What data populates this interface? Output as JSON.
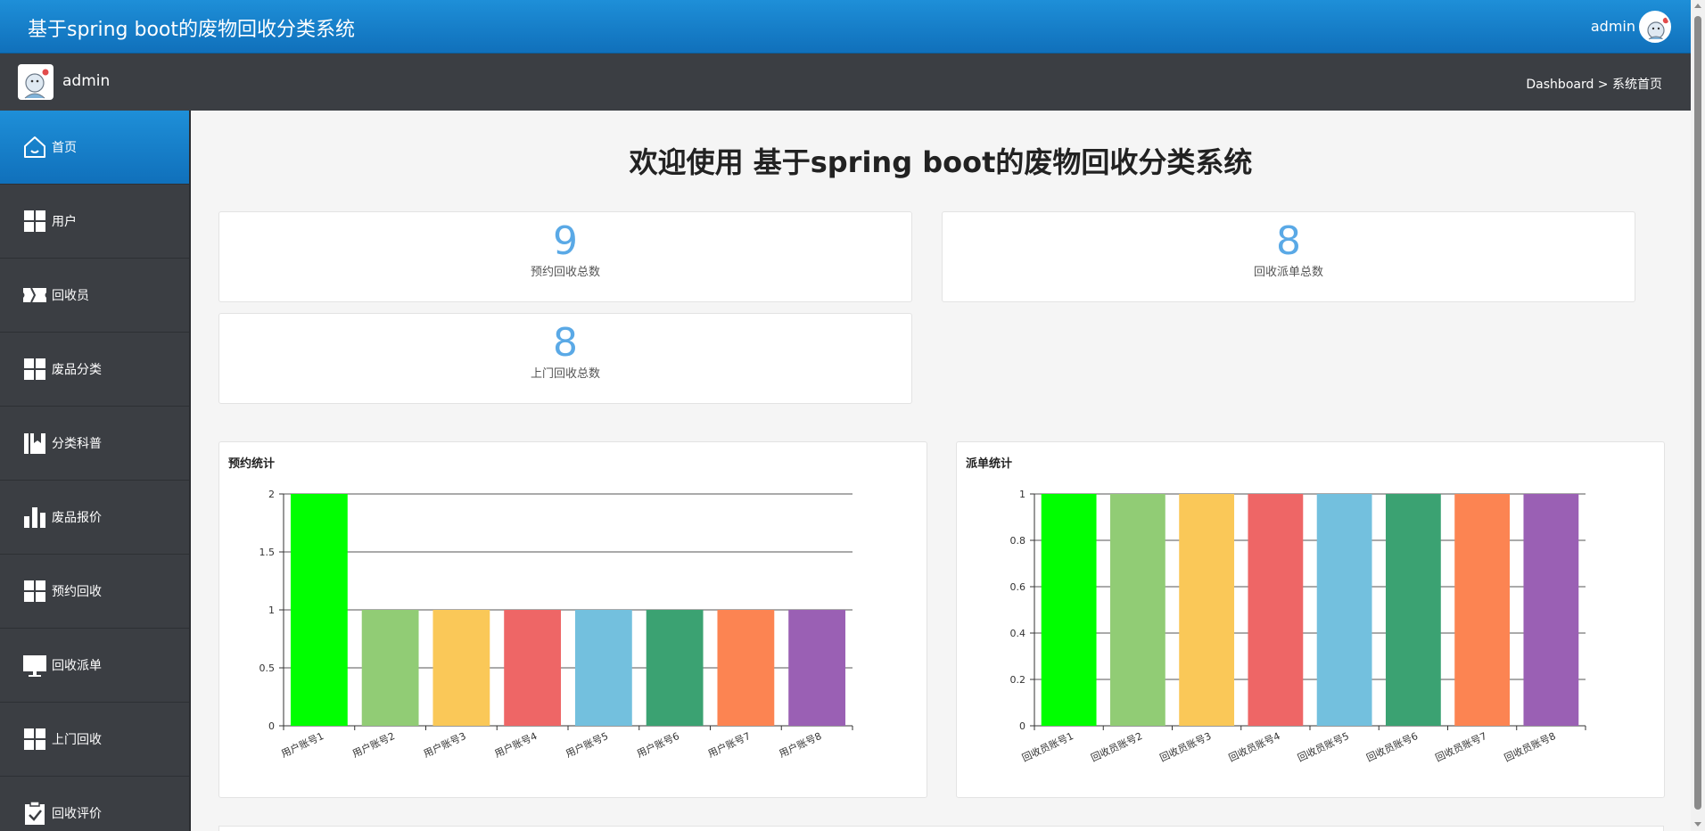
{
  "header": {
    "title": "基于spring boot的废物回收分类系统",
    "user": "admin"
  },
  "subbar": {
    "user": "admin",
    "breadcrumb": "Dashboard > 系统首页"
  },
  "sidebar": {
    "items": [
      {
        "label": "首页",
        "icon": "home-icon",
        "active": true
      },
      {
        "label": "用户",
        "icon": "grid-icon"
      },
      {
        "label": "回收员",
        "icon": "ticket-icon"
      },
      {
        "label": "废品分类",
        "icon": "grid-icon"
      },
      {
        "label": "分类科普",
        "icon": "bookmark-icon"
      },
      {
        "label": "废品报价",
        "icon": "bar-chart-icon"
      },
      {
        "label": "预约回收",
        "icon": "grid-icon"
      },
      {
        "label": "回收派单",
        "icon": "monitor-icon"
      },
      {
        "label": "上门回收",
        "icon": "grid-icon"
      },
      {
        "label": "回收评价",
        "icon": "clipboard-check-icon"
      }
    ]
  },
  "main": {
    "welcome": "欢迎使用 基于spring boot的废物回收分类系统",
    "stats": [
      {
        "value": "9",
        "label": "预约回收总数"
      },
      {
        "value": "8",
        "label": "回收派单总数"
      },
      {
        "value": "8",
        "label": "上门回收总数"
      }
    ],
    "chart_titles": [
      "预约统计",
      "派单统计"
    ]
  },
  "colors": {
    "accent": "#1a82cf",
    "bars": [
      "#00ff00",
      "#91cc75",
      "#fac858",
      "#ee6666",
      "#73c0de",
      "#3ba272",
      "#fc8452",
      "#9a60b4"
    ]
  },
  "chart_data": [
    {
      "type": "bar",
      "title": "预约统计",
      "categories": [
        "用户账号1",
        "用户账号2",
        "用户账号3",
        "用户账号4",
        "用户账号5",
        "用户账号6",
        "用户账号7",
        "用户账号8"
      ],
      "values": [
        2,
        1,
        1,
        1,
        1,
        1,
        1,
        1
      ],
      "ylim": [
        0,
        2
      ],
      "yticks": [
        "0",
        "0.5",
        "1",
        "1.5",
        "2"
      ],
      "grid": true
    },
    {
      "type": "bar",
      "title": "派单统计",
      "categories": [
        "回收员账号1",
        "回收员账号2",
        "回收员账号3",
        "回收员账号4",
        "回收员账号5",
        "回收员账号6",
        "回收员账号7",
        "回收员账号8"
      ],
      "values": [
        1,
        1,
        1,
        1,
        1,
        1,
        1,
        1
      ],
      "ylim": [
        0,
        1
      ],
      "yticks": [
        "0",
        "0.2",
        "0.4",
        "0.6",
        "0.8",
        "1"
      ],
      "grid": true
    }
  ]
}
